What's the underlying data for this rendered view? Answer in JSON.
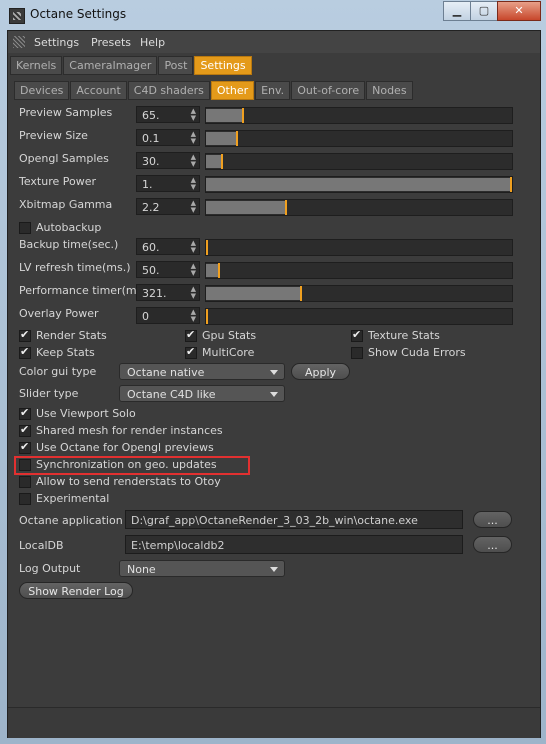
{
  "window": {
    "title": "Octane Settings",
    "minimize": "▁",
    "maximize": "▢",
    "close": "✕"
  },
  "menubar": [
    "Settings",
    "Presets",
    "Help"
  ],
  "main_tabs": [
    {
      "label": "Kernels",
      "active": false
    },
    {
      "label": "CameraImager",
      "active": false
    },
    {
      "label": "Post",
      "active": false
    },
    {
      "label": "Settings",
      "active": true
    }
  ],
  "sub_tabs": [
    {
      "label": "Devices",
      "active": false
    },
    {
      "label": "Account",
      "active": false
    },
    {
      "label": "C4D shaders",
      "active": false
    },
    {
      "label": "Other",
      "active": true
    },
    {
      "label": "Env.",
      "active": false
    },
    {
      "label": "Out-of-core",
      "active": false
    },
    {
      "label": "Nodes",
      "active": false
    }
  ],
  "params": [
    {
      "label": "Preview Samples",
      "value": "65.",
      "level": 0.12
    },
    {
      "label": "Preview Size",
      "value": "0.1",
      "level": 0.1
    },
    {
      "label": "Opengl Samples",
      "value": "30.",
      "level": 0.05
    },
    {
      "label": "Texture Power",
      "value": "1.",
      "level": 1.0
    },
    {
      "label": "Xbitmap Gamma",
      "value": "2.2",
      "level": 0.26
    }
  ],
  "autobackup": {
    "label": "Autobackup",
    "checked": false
  },
  "params2": [
    {
      "label": "Backup time(sec.)",
      "value": "60.",
      "level": 0.0
    },
    {
      "label": "LV refresh time(ms.)",
      "value": "50.",
      "level": 0.04
    },
    {
      "label": "Performance timer(ms.)",
      "value": "321.",
      "level": 0.31
    },
    {
      "label": "Overlay Power",
      "value": "0",
      "level": 0.0
    }
  ],
  "stats": [
    {
      "label": "Render Stats",
      "checked": true
    },
    {
      "label": "Gpu Stats",
      "checked": true
    },
    {
      "label": "Texture Stats",
      "checked": true
    },
    {
      "label": "Keep Stats",
      "checked": true
    },
    {
      "label": "MultiCore",
      "checked": true
    },
    {
      "label": "Show Cuda Errors",
      "checked": false
    }
  ],
  "color_gui": {
    "label": "Color gui type",
    "value": "Octane native",
    "apply": "Apply"
  },
  "slider_type": {
    "label": "Slider type",
    "value": "Octane C4D like"
  },
  "options": [
    {
      "label": "Use Viewport Solo",
      "checked": true
    },
    {
      "label": "Shared mesh for render instances",
      "checked": true
    },
    {
      "label": "Use Octane for Opengl previews",
      "checked": true
    },
    {
      "label": "Synchronization on geo. updates",
      "checked": false
    },
    {
      "label": "Allow to send renderstats to Otoy",
      "checked": false
    },
    {
      "label": "Experimental",
      "checked": false
    }
  ],
  "octane_app": {
    "label": "Octane application",
    "value": "D:\\graf_app\\OctaneRender_3_03_2b_win\\octane.exe",
    "browse": "..."
  },
  "localdb": {
    "label": "LocalDB",
    "value": "E:\\temp\\localdb2",
    "browse": "..."
  },
  "log_output": {
    "label": "Log Output",
    "value": "None"
  },
  "show_log": "Show Render Log",
  "colors": {
    "accent": "#e49a1a",
    "highlight": "#e23030"
  }
}
